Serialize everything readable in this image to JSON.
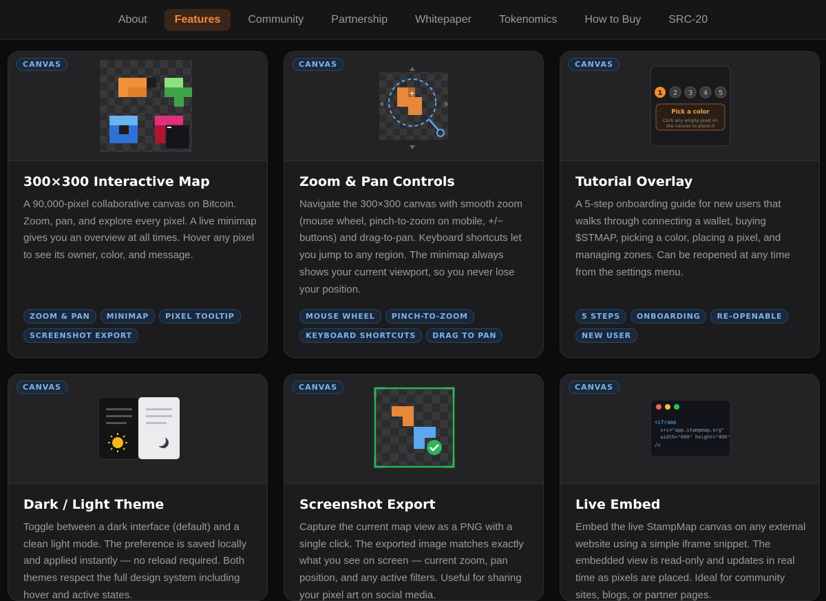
{
  "nav": {
    "items": [
      {
        "label": "About"
      },
      {
        "label": "Features",
        "active": true
      },
      {
        "label": "Community"
      },
      {
        "label": "Partnership"
      },
      {
        "label": "Whitepaper"
      },
      {
        "label": "Tokenomics"
      },
      {
        "label": "How to Buy"
      },
      {
        "label": "SRC-20"
      }
    ]
  },
  "colors": {
    "accent": "#f08a3c",
    "tag_text": "#7fb2e8",
    "card_bg": "#1c1c1e",
    "page_bg": "#0c0c0d"
  },
  "cards": [
    {
      "badge": "CANVAS",
      "title": "300×300 Interactive Map",
      "description": "A 90,000-pixel collaborative canvas on Bitcoin. Zoom, pan, and explore every pixel. A live minimap gives you an overview at all times. Hover any pixel to see its owner, color, and message.",
      "tags": [
        "ZOOM & PAN",
        "MINIMAP",
        "PIXEL TOOLTIP",
        "SCREENSHOT EXPORT"
      ],
      "illustration": "pixel-grid-icon"
    },
    {
      "badge": "CANVAS",
      "title": "Zoom & Pan Controls",
      "description": "Navigate the 300×300 canvas with smooth zoom (mouse wheel, pinch-to-zoom on mobile, +/− buttons) and drag-to-pan. Keyboard shortcuts let you jump to any region. The minimap always shows your current viewport, so you never lose your position.",
      "tags": [
        "MOUSE WHEEL",
        "PINCH-TO-ZOOM",
        "KEYBOARD SHORTCUTS",
        "DRAG TO PAN"
      ],
      "illustration": "magnifier-icon"
    },
    {
      "badge": "CANVAS",
      "title": "Tutorial Overlay",
      "description": "A 5-step onboarding guide for new users that walks through connecting a wallet, buying $STMAP, picking a color, placing a pixel, and managing zones. Can be reopened at any time from the settings menu.",
      "tags": [
        "5 STEPS",
        "ONBOARDING",
        "RE-OPENABLE",
        "NEW USER"
      ],
      "illustration": "tutorial-steps-icon",
      "mock": {
        "steps": [
          "1",
          "2",
          "3",
          "4",
          "5"
        ],
        "box_title": "Pick a color",
        "box_line1": "Click any empty pixel on",
        "box_line2": "the canvas to place it"
      }
    },
    {
      "badge": "CANVAS",
      "title": "Dark / Light Theme",
      "description": "Toggle between a dark interface (default) and a clean light mode. The preference is saved locally and applied instantly — no reload required. Both themes respect the full design system including hover and active states.",
      "tags": [],
      "illustration": "theme-toggle-icon"
    },
    {
      "badge": "CANVAS",
      "title": "Screenshot Export",
      "description": "Capture the current map view as a PNG with a single click. The exported image matches exactly what you see on screen — current zoom, pan position, and any active filters. Useful for sharing your pixel art on social media.",
      "tags": [],
      "illustration": "screenshot-check-icon"
    },
    {
      "badge": "CANVAS",
      "title": "Live Embed",
      "description": "Embed the live StampMap canvas on any external website using a simple iframe snippet. The embedded view is read-only and updates in real time as pixels are placed. Ideal for community sites, blogs, or partner pages.",
      "tags": [],
      "illustration": "code-window-icon",
      "mock": {
        "code1": "<iframe",
        "code2": "  src=\"app.stampmap.org\"",
        "code3": "  width=\"600\" height=\"400\"",
        "code4": "/>"
      }
    }
  ]
}
